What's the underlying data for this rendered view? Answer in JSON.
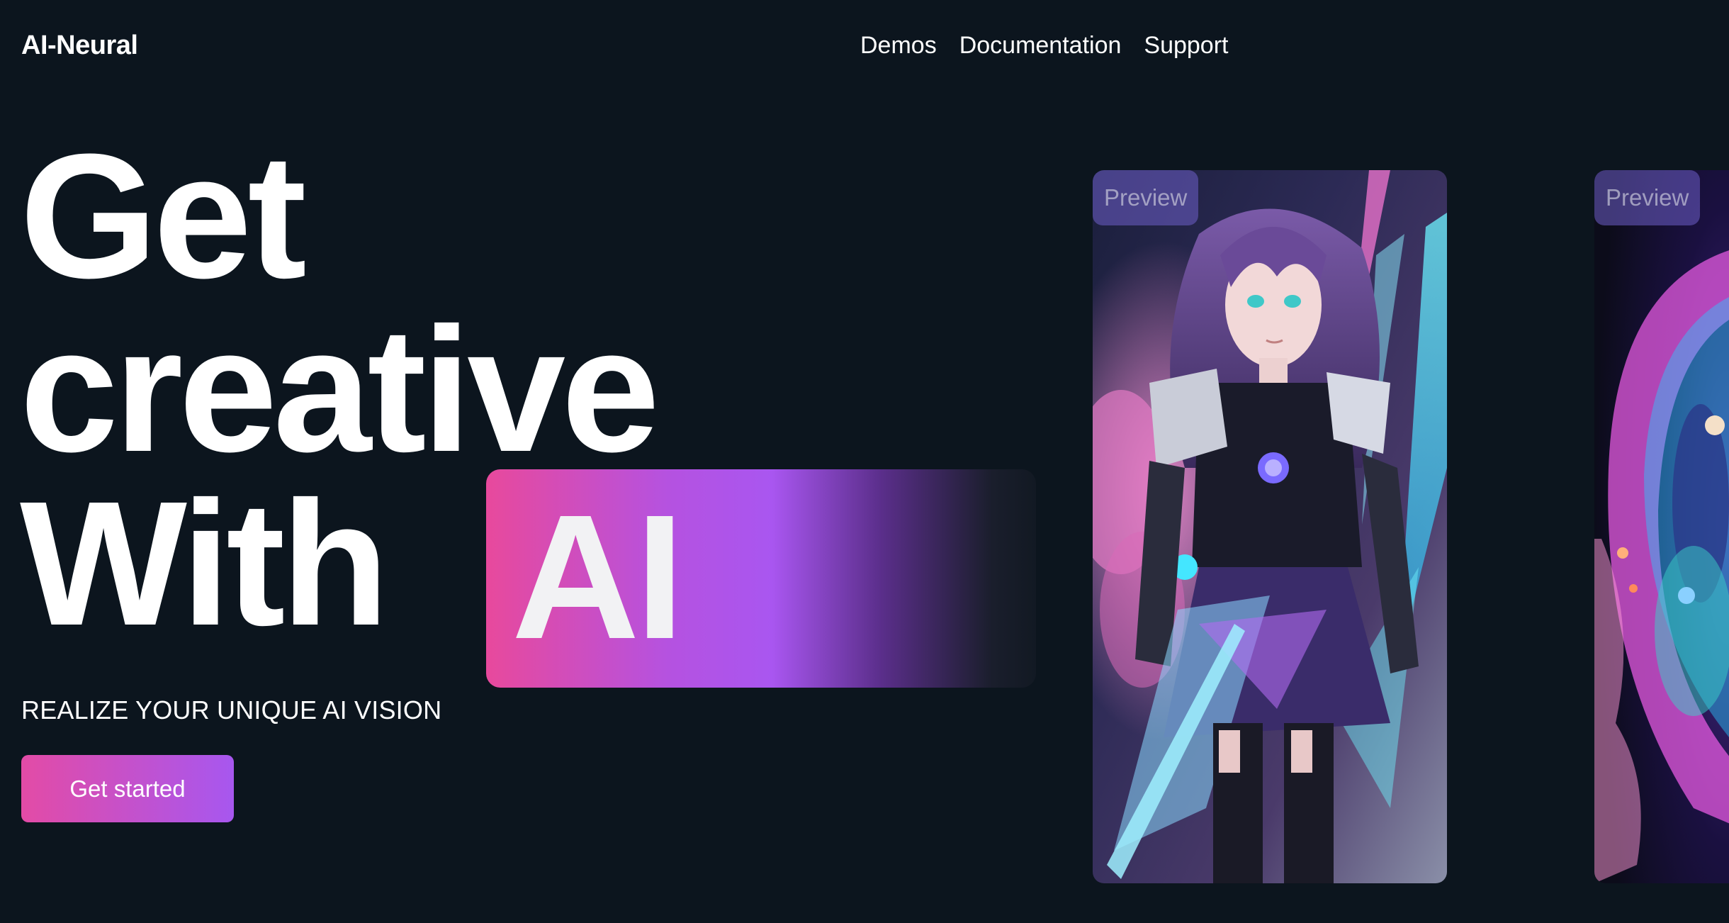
{
  "header": {
    "brand": "AI-Neural",
    "nav": [
      "Demos",
      "Documentation",
      "Support"
    ]
  },
  "hero": {
    "line1": "Get",
    "line2": "creative",
    "line3": "With",
    "highlight": "AI",
    "tagline": "REALIZE YOUR UNIQUE AI VISION",
    "cta_label": "Get started"
  },
  "gallery": {
    "cards": [
      {
        "badge": "Preview"
      },
      {
        "badge": "Preview"
      }
    ]
  },
  "colors": {
    "background": "#0c151e",
    "accent_pink": "#e8499c",
    "accent_purple": "#a956f0",
    "text": "#ffffff"
  }
}
